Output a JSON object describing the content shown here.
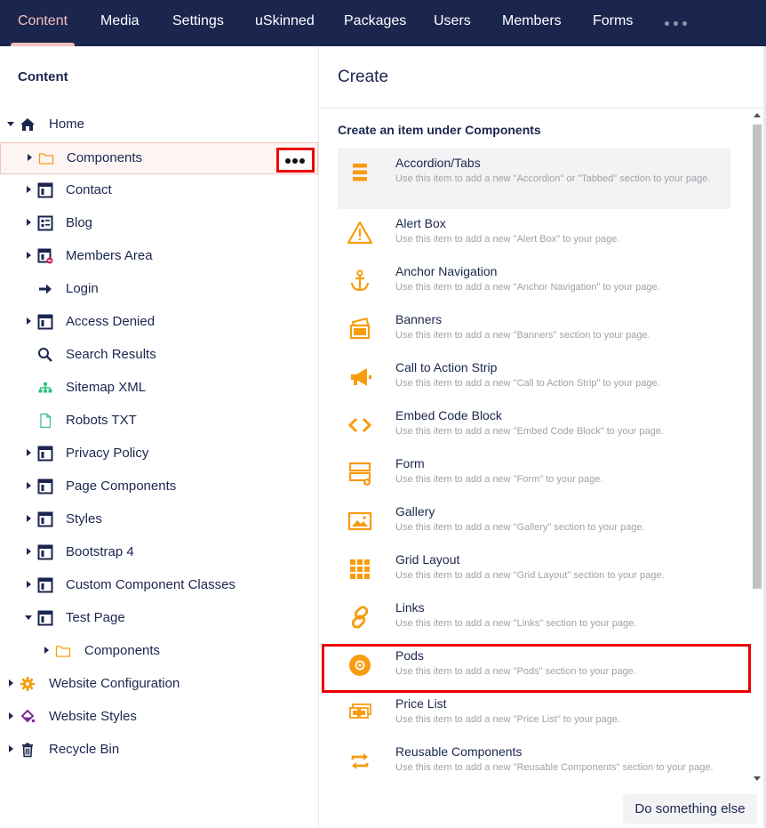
{
  "nav": {
    "tabs": [
      {
        "label": "Content",
        "active": true
      },
      {
        "label": "Media"
      },
      {
        "label": "Settings"
      },
      {
        "label": "uSkinned"
      },
      {
        "label": "Packages"
      },
      {
        "label": "Users"
      },
      {
        "label": "Members"
      },
      {
        "label": "Forms"
      }
    ],
    "more_icon": "ellipsis-icon"
  },
  "tree": {
    "title": "Content",
    "nodes": [
      {
        "label": "Home",
        "icon": "home-icon",
        "expanded": true
      },
      {
        "label": "Components",
        "icon": "folder-icon",
        "selected": true,
        "actions_icon": "ellipsis-icon"
      },
      {
        "label": "Contact",
        "icon": "page-layout-icon"
      },
      {
        "label": "Blog",
        "icon": "blog-list-icon"
      },
      {
        "label": "Members Area",
        "icon": "members-page-icon"
      },
      {
        "label": "Login",
        "icon": "arrow-right-icon"
      },
      {
        "label": "Access Denied",
        "icon": "page-layout-icon"
      },
      {
        "label": "Search Results",
        "icon": "search-icon"
      },
      {
        "label": "Sitemap XML",
        "icon": "sitemap-icon"
      },
      {
        "label": "Robots TXT",
        "icon": "document-icon"
      },
      {
        "label": "Privacy Policy",
        "icon": "page-layout-icon"
      },
      {
        "label": "Page Components",
        "icon": "page-layout-icon"
      },
      {
        "label": "Styles",
        "icon": "page-layout-icon"
      },
      {
        "label": "Bootstrap 4",
        "icon": "page-layout-icon"
      },
      {
        "label": "Custom Component Classes",
        "icon": "page-layout-icon"
      },
      {
        "label": "Test Page",
        "icon": "page-layout-icon",
        "expanded": true
      },
      {
        "label": "Components",
        "icon": "folder-icon"
      },
      {
        "label": "Website Configuration",
        "icon": "gear-icon"
      },
      {
        "label": "Website Styles",
        "icon": "paint-bucket-icon"
      },
      {
        "label": "Recycle Bin",
        "icon": "trash-icon"
      }
    ]
  },
  "panel": {
    "title": "Create",
    "subtitle": "Create an item under Components",
    "items": [
      {
        "name": "Accordion/Tabs",
        "desc": "Use this item to add a new \"Accordion\" or \"Tabbed\" section to your page.",
        "icon": "accordion-icon"
      },
      {
        "name": "Alert Box",
        "desc": "Use this item to add a new \"Alert Box\" to your page.",
        "icon": "warning-icon"
      },
      {
        "name": "Anchor Navigation",
        "desc": "Use this item to add a new \"Anchor Navigation\" to your page.",
        "icon": "anchor-icon"
      },
      {
        "name": "Banners",
        "desc": "Use this item to add a new \"Banners\" section to your page.",
        "icon": "banners-icon"
      },
      {
        "name": "Call to Action Strip",
        "desc": "Use this item to add a new \"Call to Action Strip\" to your page.",
        "icon": "megaphone-icon"
      },
      {
        "name": "Embed Code Block",
        "desc": "Use this item to add a new \"Embed Code Block\" to your page.",
        "icon": "code-icon"
      },
      {
        "name": "Form",
        "desc": "Use this item to add a new \"Form\" to your page.",
        "icon": "form-icon"
      },
      {
        "name": "Gallery",
        "desc": "Use this item to add a new \"Gallery\" section to your page.",
        "icon": "image-icon"
      },
      {
        "name": "Grid Layout",
        "desc": "Use this item to add a new \"Grid Layout\" section to your page.",
        "icon": "grid-icon"
      },
      {
        "name": "Links",
        "desc": "Use this item to add a new \"Links\" section to your page.",
        "icon": "link-icon"
      },
      {
        "name": "Pods",
        "desc": "Use this item to add a new \"Pods\" section to your page.",
        "icon": "pod-icon"
      },
      {
        "name": "Price List",
        "desc": "Use this item to add a new \"Price List\" to your page.",
        "icon": "price-list-icon"
      },
      {
        "name": "Reusable Components",
        "desc": "Use this item to add a new \"Reusable Components\" section to your page.",
        "icon": "reusable-icon"
      }
    ]
  },
  "footer": {
    "button_label": "Do something else"
  },
  "colors": {
    "nav_bg": "#1b264f",
    "accent": "#f5c1bc",
    "icon_orange": "#f79c0f",
    "highlight_red": "#ee0000"
  }
}
